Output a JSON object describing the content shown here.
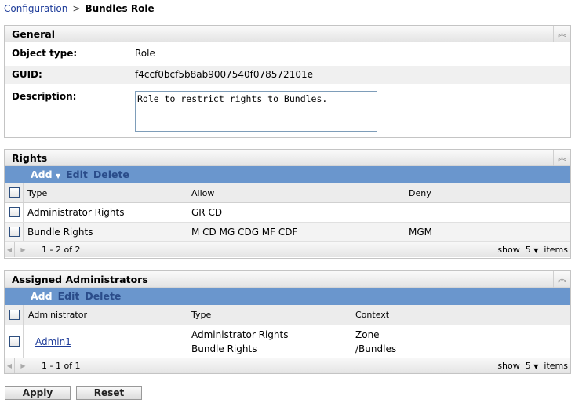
{
  "breadcrumb": {
    "parent": "Configuration",
    "separator": ">",
    "current": "Bundles Role"
  },
  "general": {
    "title": "General",
    "object_type_label": "Object type:",
    "object_type": "Role",
    "guid_label": "GUID:",
    "guid": "f4ccf0bcf5b8ab9007540f078572101e",
    "description_label": "Description:",
    "description": "Role to restrict rights to Bundles."
  },
  "rights": {
    "title": "Rights",
    "toolbar": {
      "add": "Add",
      "edit": "Edit",
      "delete": "Delete"
    },
    "columns": [
      "Type",
      "Allow",
      "Deny"
    ],
    "rows": [
      {
        "type": "Administrator Rights",
        "allow": "GR CD",
        "deny": ""
      },
      {
        "type": "Bundle Rights",
        "allow": "M CD MG CDG MF CDF",
        "deny": "MGM"
      }
    ],
    "pagination": "1 - 2 of 2",
    "show": "show",
    "page_size": "5",
    "items": "items"
  },
  "admins": {
    "title": "Assigned Administrators",
    "toolbar": {
      "add": "Add",
      "edit": "Edit",
      "delete": "Delete"
    },
    "columns": [
      "Administrator",
      "Type",
      "Context"
    ],
    "rows": [
      {
        "name": "Admin1",
        "types": [
          "Administrator Rights",
          "Bundle Rights"
        ],
        "contexts": [
          "Zone",
          "/Bundles"
        ]
      }
    ],
    "pagination": "1 - 1 of 1",
    "show": "show",
    "page_size": "5",
    "items": "items"
  },
  "buttons": {
    "apply": "Apply",
    "reset": "Reset"
  }
}
